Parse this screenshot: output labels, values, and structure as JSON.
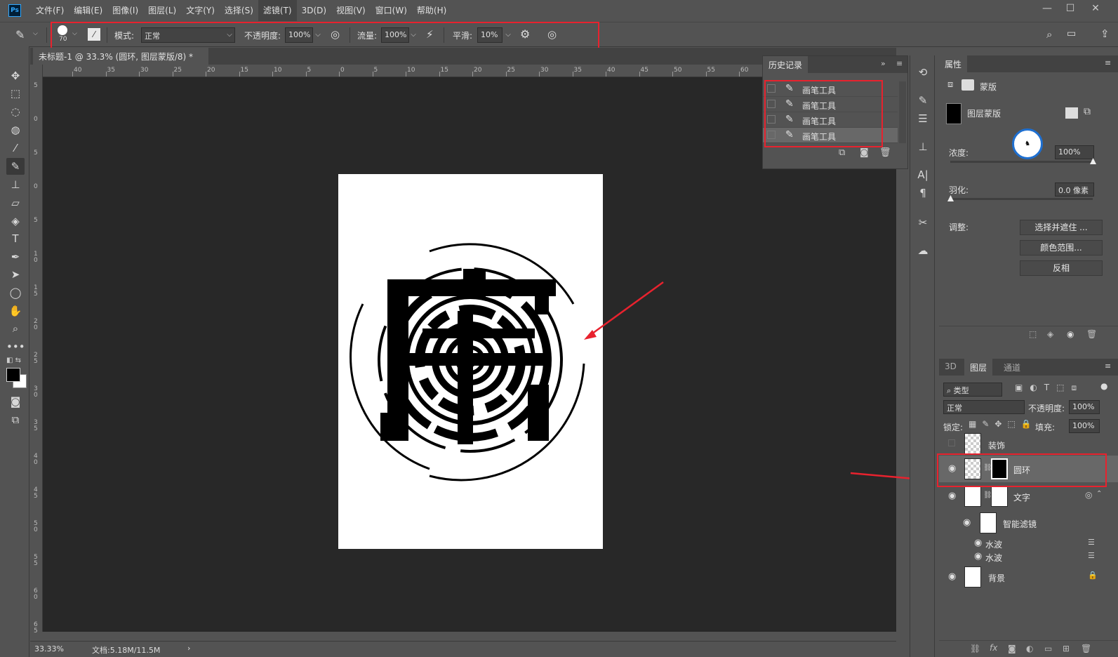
{
  "menu": [
    "文件(F)",
    "编辑(E)",
    "图像(I)",
    "图层(L)",
    "文字(Y)",
    "选择(S)",
    "滤镜(T)",
    "3D(D)",
    "视图(V)",
    "窗口(W)",
    "帮助(H)"
  ],
  "app_logo": "Ps",
  "options": {
    "brush_size": "70",
    "mode_label": "模式:",
    "mode_value": "正常",
    "opacity_label": "不透明度:",
    "opacity_value": "100%",
    "flow_label": "流量:",
    "flow_value": "100%",
    "smooth_label": "平滑:",
    "smooth_value": "10%"
  },
  "document": {
    "tab_title": "未标题-1 @ 33.3% (圆环, 图层蒙版/8) *",
    "zoom": "33.33%",
    "doc_info": "文档:5.18M/11.5M"
  },
  "ruler": {
    "h": [
      "40",
      "35",
      "30",
      "25",
      "20",
      "15",
      "10",
      "5",
      "0",
      "5",
      "10",
      "15",
      "20",
      "25",
      "30",
      "35",
      "40",
      "45",
      "50",
      "55",
      "60"
    ],
    "v": [
      "5",
      "0",
      "5",
      "0",
      "5",
      "1\n0",
      "1\n5",
      "2\n0",
      "2\n5",
      "3\n0",
      "3\n5",
      "4\n0",
      "4\n5",
      "5\n0",
      "5\n5",
      "6\n0",
      "6\n5"
    ]
  },
  "history": {
    "title": "历史记录",
    "items": [
      "画笔工具",
      "画笔工具",
      "画笔工具",
      "画笔工具"
    ]
  },
  "properties": {
    "title": "属性",
    "mask_label": "蒙版",
    "layer_mask_label": "图层蒙版",
    "density_label": "浓度:",
    "density_value": "100%",
    "density": 1.0,
    "feather_label": "羽化:",
    "feather_value": "0.0 像素",
    "feather": 0.0,
    "adjust_label": "调整:",
    "btn_select_mask": "选择并遮住 ...",
    "btn_color_range": "颜色范围...",
    "btn_invert": "反相"
  },
  "layers_panel": {
    "tabs": [
      "3D",
      "图层",
      "通道"
    ],
    "filter_label": "类型",
    "blend_mode": "正常",
    "opacity_label": "不透明度:",
    "opacity_value": "100%",
    "lock_label": "锁定:",
    "fill_label": "填充:",
    "fill_value": "100%",
    "layers": [
      {
        "name": "装饰",
        "visible": false
      },
      {
        "name": "圆环",
        "visible": true,
        "selected": true
      },
      {
        "name": "文字",
        "visible": true
      },
      {
        "name": "智能滤镜",
        "visible": true
      },
      {
        "name": "水波",
        "visible": true
      },
      {
        "name": "水波",
        "visible": true
      },
      {
        "name": "背景",
        "visible": true
      }
    ]
  },
  "accent_colors": {
    "highlight_box": "#e8222e",
    "arrow": "#e8222e"
  }
}
